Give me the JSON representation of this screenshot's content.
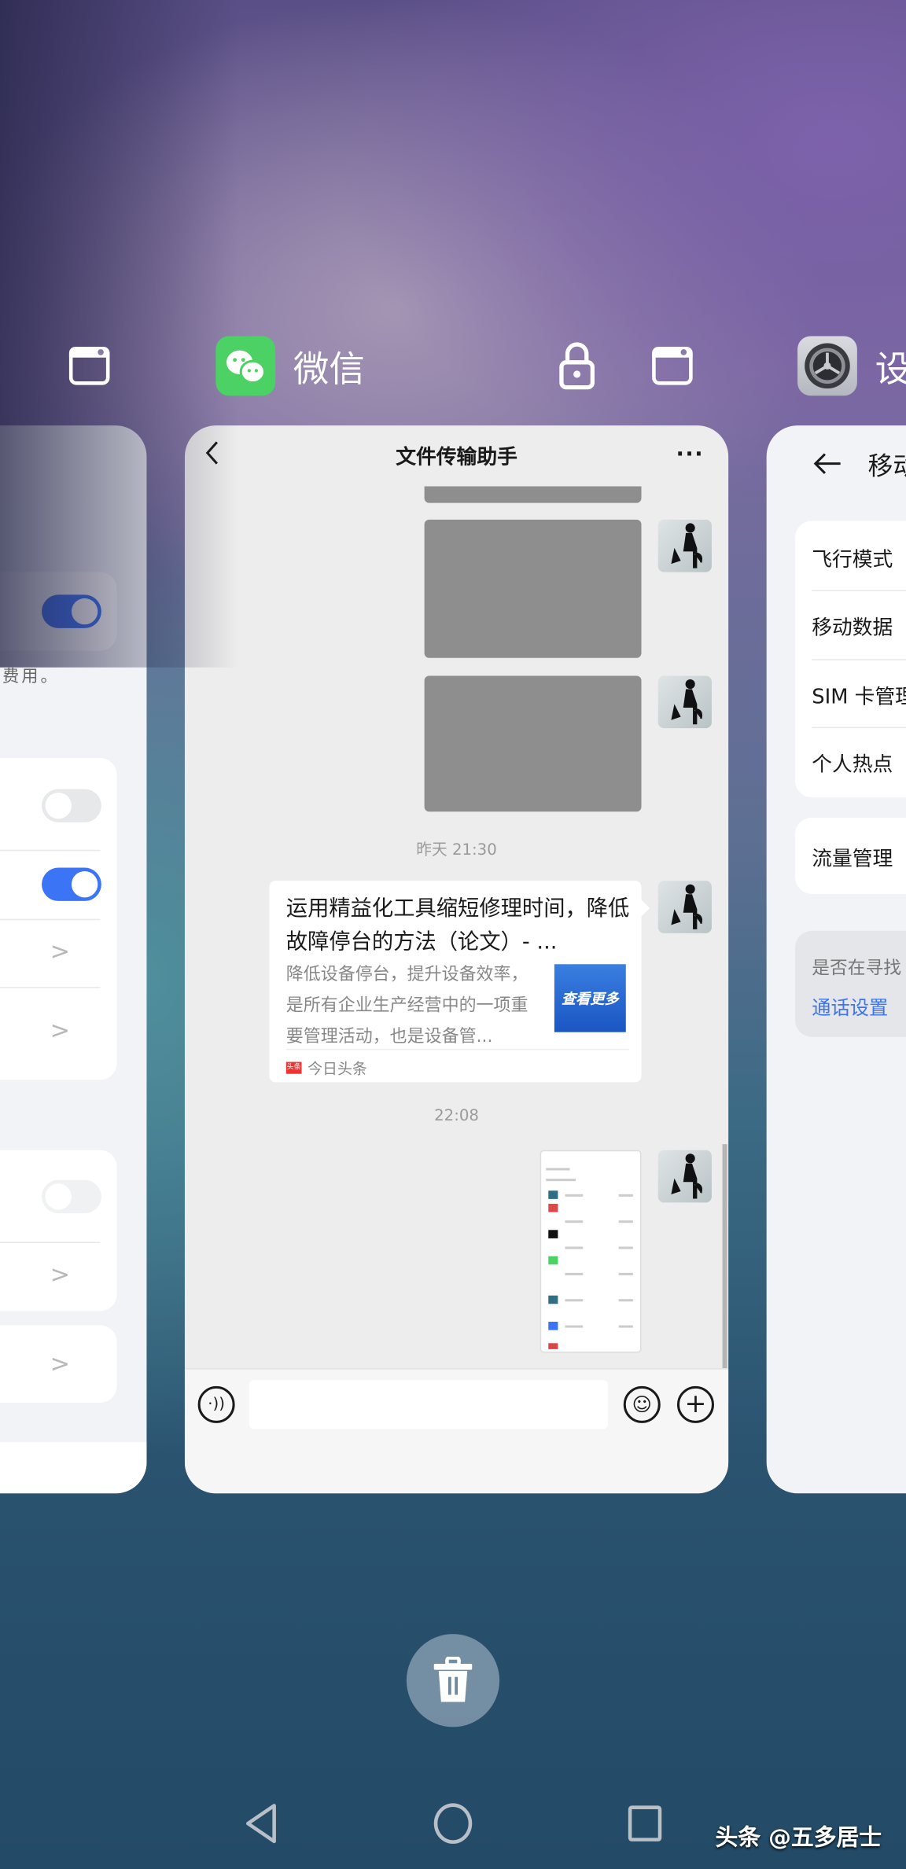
{
  "recents": {
    "apps": [
      {
        "label": "",
        "icon": "window-icon"
      },
      {
        "label": "微信",
        "icon": "wechat-icon"
      },
      {
        "label": "设",
        "icon": "settings-gear-icon"
      }
    ],
    "lock_icon": "lock-icon"
  },
  "left_card": {
    "note_fragment": "费用。",
    "toggles": {
      "row1": true,
      "row2": false,
      "row3": true,
      "row4": false
    }
  },
  "wechat": {
    "title": "文件传输助手",
    "timestamp_1": "昨天 21:30",
    "timestamp_2": "22:08",
    "link": {
      "title": "运用精益化工具缩短修理时间，降低故障停台的方法（论文）- ...",
      "description": "降低设备停台，提升设备效率，是所有企业生产经营中的一项重要管理活动，也是设备管...",
      "thumb_text": "查看更多",
      "source": "今日头条",
      "source_logo": "头条"
    },
    "input_placeholder": ""
  },
  "settings_card": {
    "title": "移动",
    "rows": [
      "飞行模式",
      "移动数据",
      "SIM 卡管理",
      "个人热点"
    ],
    "row_traffic": "流量管理",
    "hint": "是否在寻找",
    "hint_link": "通话设置",
    "link_color": "#3b74f5"
  },
  "watermark": "头条 @五多居士"
}
